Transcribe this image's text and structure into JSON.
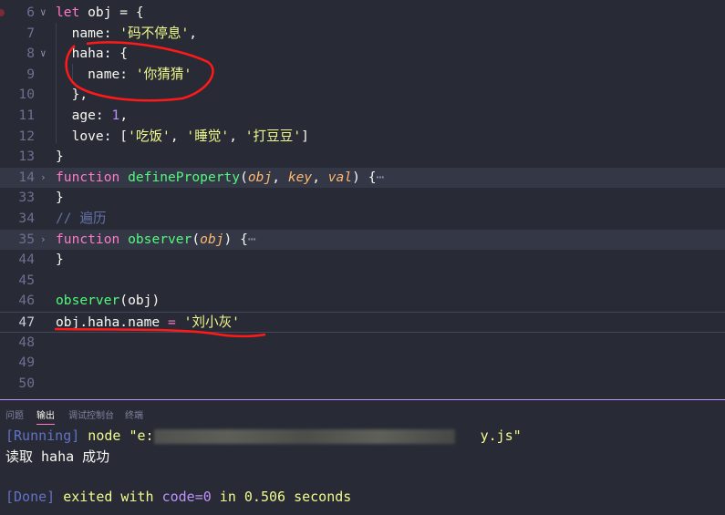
{
  "editor": {
    "lines": [
      {
        "n": "6",
        "fold": "open"
      },
      {
        "n": "7"
      },
      {
        "n": "8",
        "fold": "open"
      },
      {
        "n": "9"
      },
      {
        "n": "10"
      },
      {
        "n": "11"
      },
      {
        "n": "12"
      },
      {
        "n": "13"
      },
      {
        "n": "14",
        "fold": "closed"
      },
      {
        "n": "33"
      },
      {
        "n": "34"
      },
      {
        "n": "35",
        "fold": "closed"
      },
      {
        "n": "44"
      },
      {
        "n": "45"
      },
      {
        "n": "46"
      },
      {
        "n": "47"
      },
      {
        "n": "48"
      },
      {
        "n": "49"
      },
      {
        "n": "50"
      }
    ],
    "code": {
      "l6_kw": "let",
      "l6_rest": " obj = {",
      "l7_key": "  name: ",
      "l7_str": "'码不停息'",
      "l7_end": ",",
      "l8": "  haha: {",
      "l9_key": "    name: ",
      "l9_str": "'你猜猜'",
      "l10": "  },",
      "l11_key": "  age: ",
      "l11_num": "1",
      "l11_end": ",",
      "l12_key": "  love: [",
      "l12_s1": "'吃饭'",
      "l12_c1": ", ",
      "l12_s2": "'睡觉'",
      "l12_c2": ", ",
      "l12_s3": "'打豆豆'",
      "l12_end": "]",
      "l13": "}",
      "l14_kw": "function",
      "l14_fn": " defineProperty",
      "l14_p0": "(",
      "l14_a1": "obj",
      "l14_c1": ", ",
      "l14_a2": "key",
      "l14_c2": ", ",
      "l14_a3": "val",
      "l14_end": ") {",
      "l14_fold": "⋯",
      "l33": "}",
      "l34": "// 遍历",
      "l35_kw": "function",
      "l35_fn": " observer",
      "l35_p0": "(",
      "l35_a1": "obj",
      "l35_end": ") {",
      "l35_fold": "⋯",
      "l44": "}",
      "l46_fn": "observer",
      "l46_rest": "(obj)",
      "l47_a": "obj.haha.name ",
      "l47_op": "=",
      "l47_sp": " ",
      "l47_str": "'刘小灰'"
    }
  },
  "panel": {
    "tabs": [
      "问题",
      "输出",
      "调试控制台",
      "终端"
    ],
    "active_tab": "输出",
    "output": {
      "running_tag": "[Running]",
      "running_cmd": " node \"e:",
      "running_tail": "y.js\"",
      "log": "读取 haha 成功",
      "done_tag": "[Done]",
      "done_a": " exited with ",
      "done_code": "code=0",
      "done_b": " in 0.506 seconds"
    }
  },
  "colors": {
    "background": "#282a36",
    "keyword": "#ff79c6",
    "function": "#50fa7b",
    "string": "#f1fa8c",
    "number": "#bd93f9",
    "annotation": "#ff0000"
  }
}
